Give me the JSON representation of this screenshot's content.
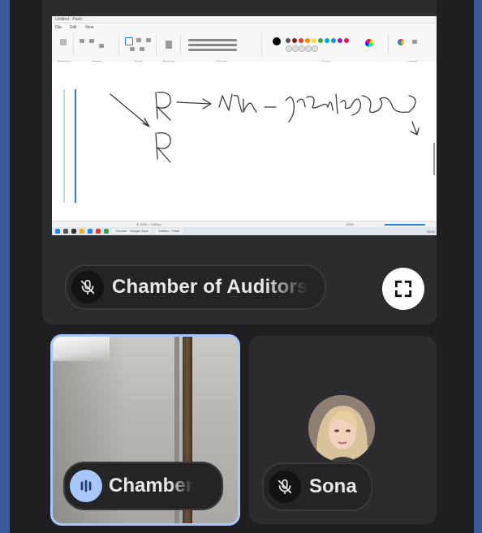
{
  "main_tile": {
    "participant_label": "Chamber of Auditors",
    "mic_status": "muted",
    "fullscreen_icon": "fullscreen-icon"
  },
  "shared_screen": {
    "window_title": "Untitled - Paint",
    "menu": [
      "File",
      "Edit",
      "View"
    ],
    "ribbon_groups": [
      "Selection",
      "Image",
      "Tools",
      "Brushes",
      "Shapes",
      "Colors",
      "Layers"
    ],
    "handwriting": {
      "line1": "R ⟶ N∕₆R — Ψ SwahBy)",
      "line2": "R"
    },
    "zoom": "100%",
    "status_left": "Ф 1920 × 1080px",
    "taskbar_tabs": [
      "Chrome · Google Docs",
      "Untitled - Paint"
    ],
    "taskbar_time": "20:11"
  },
  "self_tile": {
    "participant_label": "Chamber",
    "audio_indicator": "speaking-bars-icon"
  },
  "sona_tile": {
    "participant_label": "Sona",
    "mic_status": "muted"
  },
  "colors": {
    "background": "#3b5a98",
    "tile": "#2c2c2f",
    "active_border": "#a9c7ff"
  }
}
